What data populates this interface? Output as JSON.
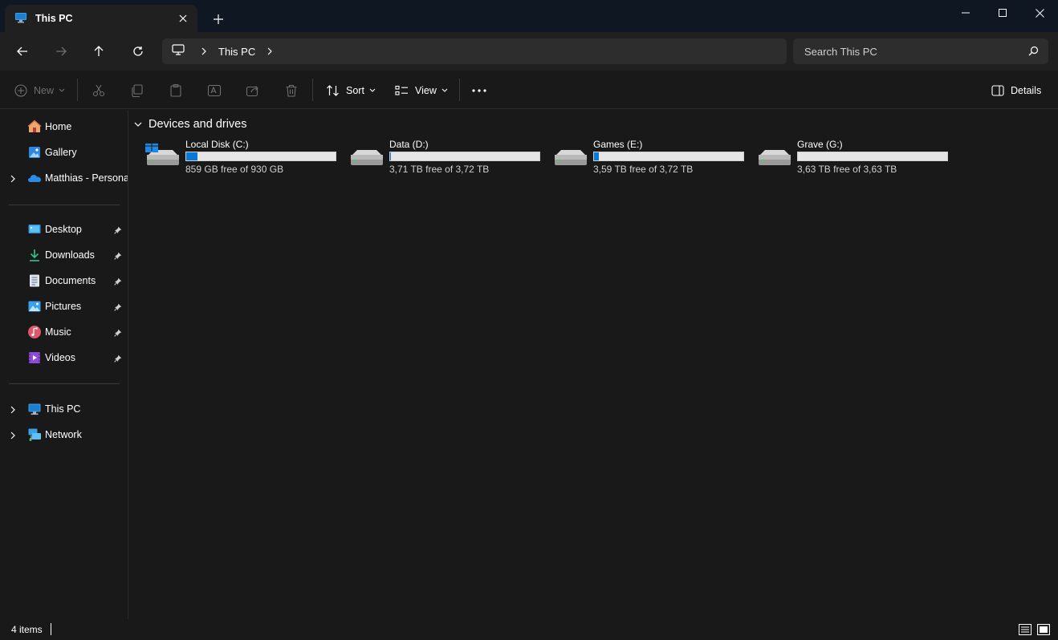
{
  "window": {
    "tab_title": "This PC",
    "controls": {
      "minimize": "minimize-icon",
      "maximize": "maximize-icon",
      "close": "close-icon"
    }
  },
  "address": {
    "segments": [
      "This PC"
    ]
  },
  "search": {
    "placeholder": "Search This PC"
  },
  "toolbar": {
    "new_label": "New",
    "sort_label": "Sort",
    "view_label": "View",
    "details_label": "Details"
  },
  "sidebar": {
    "top": [
      {
        "label": "Home",
        "icon": "home-icon"
      },
      {
        "label": "Gallery",
        "icon": "gallery-icon"
      },
      {
        "label": "Matthias - Personal",
        "icon": "onedrive-icon",
        "expandable": true
      }
    ],
    "pinned": [
      {
        "label": "Desktop",
        "icon": "desktop-icon",
        "pinned": true
      },
      {
        "label": "Downloads",
        "icon": "downloads-icon",
        "pinned": true
      },
      {
        "label": "Documents",
        "icon": "documents-icon",
        "pinned": true
      },
      {
        "label": "Pictures",
        "icon": "pictures-icon",
        "pinned": true
      },
      {
        "label": "Music",
        "icon": "music-icon",
        "pinned": true
      },
      {
        "label": "Videos",
        "icon": "videos-icon",
        "pinned": true
      }
    ],
    "bottom": [
      {
        "label": "This PC",
        "icon": "this-pc-icon",
        "expandable": true
      },
      {
        "label": "Network",
        "icon": "network-icon",
        "expandable": true
      }
    ]
  },
  "content": {
    "group_title": "Devices and drives",
    "drives": [
      {
        "name": "Local Disk (C:)",
        "free_text": "859 GB free of 930 GB",
        "used_fraction": 0.0763,
        "system": true
      },
      {
        "name": "Data (D:)",
        "free_text": "3,71 TB free of 3,72 TB",
        "used_fraction": 0.0027,
        "system": false
      },
      {
        "name": "Games (E:)",
        "free_text": "3,59 TB free of 3,72 TB",
        "used_fraction": 0.0349,
        "system": false
      },
      {
        "name": "Grave (G:)",
        "free_text": "3,63 TB free of 3,63 TB",
        "used_fraction": 0.0,
        "system": false
      }
    ]
  },
  "status": {
    "items_text": "4 items"
  },
  "colors": {
    "accent": "#0b78d6",
    "background": "#191919",
    "titlebar": "#0f1722"
  }
}
